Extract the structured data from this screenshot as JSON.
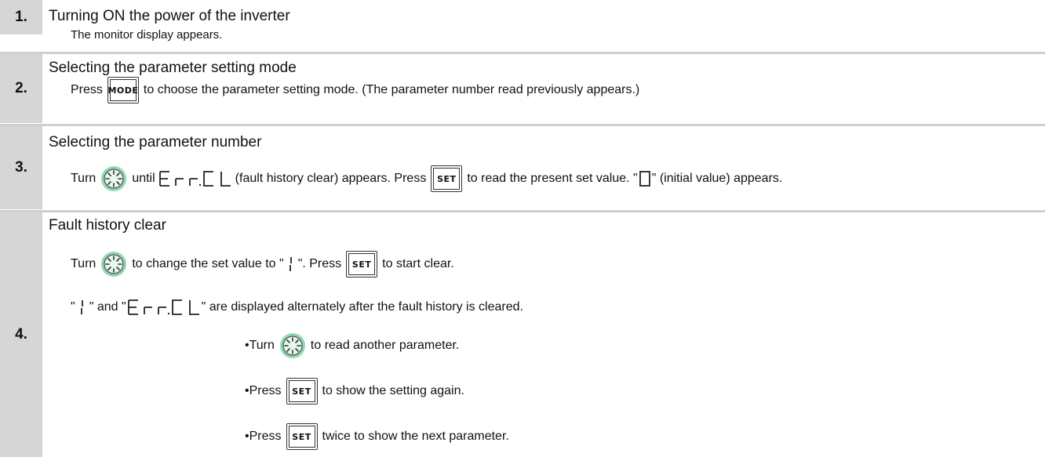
{
  "steps": [
    {
      "number": "1.",
      "title": "Turning ON the power of the inverter",
      "text": "The monitor display appears."
    },
    {
      "number": "2.",
      "title": "Selecting the parameter setting mode",
      "text_a": "Press",
      "key": "MODE",
      "text_b": "to choose the parameter setting mode. (The parameter number read previously appears.)"
    },
    {
      "number": "3.",
      "title": "Selecting the parameter number",
      "text_a": "Turn",
      "text_b": "until",
      "text_c": "(fault history clear) appears. Press",
      "key": "SET",
      "text_d": "to read the present set value. \"",
      "text_e": "\" (initial value) appears."
    },
    {
      "number": "4.",
      "title": "Fault history clear",
      "line1_a": "Turn",
      "line1_b": "to change the set value to \"",
      "line1_c": "\". Press",
      "line1_key": "SET",
      "line1_d": "to start clear.",
      "line2_a": "\"",
      "line2_b": "\" and \"",
      "line2_c": " \" are displayed alternately after the fault history is cleared.",
      "bullet1_a": "•Turn",
      "bullet1_b": "to read another parameter.",
      "bullet2_a": "•Press",
      "bullet2_key": "SET",
      "bullet2_b": "to show the setting again.",
      "bullet3_a": "•Press",
      "bullet3_key": "SET",
      "bullet3_b": "twice to show the next parameter."
    }
  ],
  "display_codes": {
    "err_cl": "Err.CL",
    "zero": "0",
    "one": "1"
  },
  "colors": {
    "number_column": "#d6d6d6",
    "separator": "#cfcfcf",
    "dial_green": "#7fd0a4"
  }
}
